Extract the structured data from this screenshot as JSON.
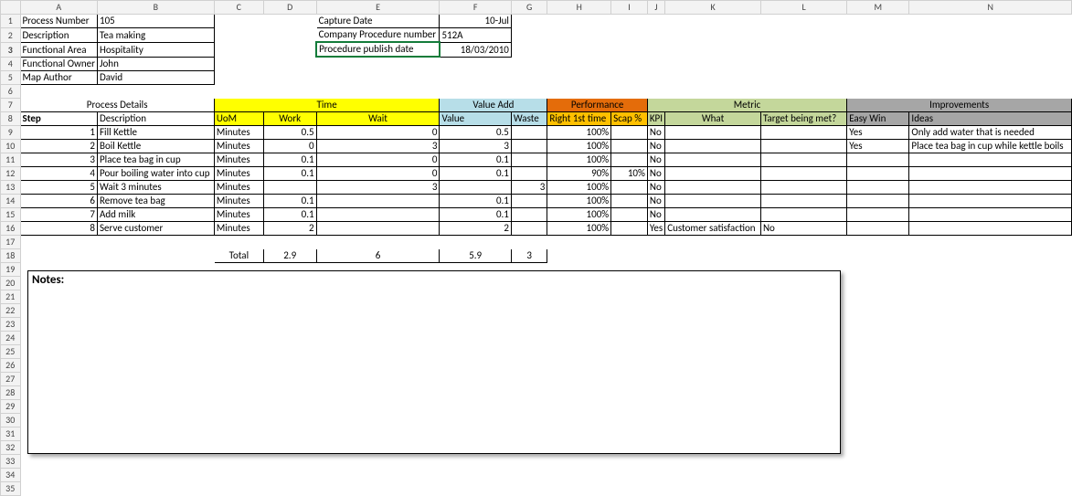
{
  "columns": [
    "",
    "A",
    "B",
    "C",
    "D",
    "E",
    "F",
    "G",
    "H",
    "I",
    "J",
    "K",
    "L",
    "M",
    "N"
  ],
  "rowNumbers": [
    1,
    2,
    3,
    4,
    5,
    6,
    7,
    8,
    9,
    10,
    11,
    12,
    13,
    14,
    15,
    16,
    17,
    18,
    19,
    20,
    21,
    22,
    23,
    24,
    25,
    26,
    27,
    28,
    29,
    30,
    31,
    32,
    33,
    34,
    35
  ],
  "meta": {
    "processNumberLabel": "Process  Number",
    "processNumber": "105",
    "descriptionLabel": "Description",
    "description": "Tea making",
    "functionalAreaLabel": "Functional Area",
    "functionalArea": "Hospitality",
    "functionalOwnerLabel": "Functional Owner",
    "functionalOwner": "John",
    "mapAuthorLabel": "Map Author",
    "mapAuthor": "David",
    "captureDateLabel": "Capture Date",
    "captureDate": "10-Jul",
    "companyProcLabel": "Company Procedure number",
    "companyProc": "512A",
    "publishDateLabel": "Procedure publish date",
    "publishDate": "18/03/2010"
  },
  "groupHeaders": {
    "processDetails": "Process Details",
    "time": "Time",
    "valueAdd": "Value Add",
    "performance": "Performance",
    "metric": "Metric",
    "improvements": "Improvements"
  },
  "headers": {
    "step": "Step",
    "desc": "Description",
    "uom": "UoM",
    "work": "Work",
    "wait": "Wait",
    "value": "Value",
    "waste": "Waste",
    "right": "Right 1st time",
    "scap": "Scap %",
    "kpi": "KPI",
    "what": "What",
    "target": "Target being met?",
    "easy": "Easy Win",
    "ideas": "Ideas"
  },
  "rows": [
    {
      "step": "1",
      "desc": "Fill Kettle",
      "uom": "Minutes",
      "work": "0.5",
      "wait": "0",
      "value": "0.5",
      "waste": "",
      "right": "100%",
      "scap": "",
      "kpi": "No",
      "what": "",
      "target": "",
      "easy": "Yes",
      "ideas": "Only add water that is needed"
    },
    {
      "step": "2",
      "desc": "Boil Kettle",
      "uom": "Minutes",
      "work": "0",
      "wait": "3",
      "value": "3",
      "waste": "",
      "right": "100%",
      "scap": "",
      "kpi": "No",
      "what": "",
      "target": "",
      "easy": "Yes",
      "ideas": "Place tea bag in cup while kettle boils"
    },
    {
      "step": "3",
      "desc": "Place tea bag in cup",
      "uom": "Minutes",
      "work": "0.1",
      "wait": "0",
      "value": "0.1",
      "waste": "",
      "right": "100%",
      "scap": "",
      "kpi": "No",
      "what": "",
      "target": "",
      "easy": "",
      "ideas": ""
    },
    {
      "step": "4",
      "desc": "Pour boiling water into cup",
      "uom": "Minutes",
      "work": "0.1",
      "wait": "0",
      "value": "0.1",
      "waste": "",
      "right": "90%",
      "scap": "10%",
      "kpi": "No",
      "what": "",
      "target": "",
      "easy": "",
      "ideas": ""
    },
    {
      "step": "5",
      "desc": "Wait 3 minutes",
      "uom": "Minutes",
      "work": "",
      "wait": "3",
      "value": "",
      "waste": "3",
      "right": "100%",
      "scap": "",
      "kpi": "No",
      "what": "",
      "target": "",
      "easy": "",
      "ideas": ""
    },
    {
      "step": "6",
      "desc": "Remove tea bag",
      "uom": "Minutes",
      "work": "0.1",
      "wait": "",
      "value": "0.1",
      "waste": "",
      "right": "100%",
      "scap": "",
      "kpi": "No",
      "what": "",
      "target": "",
      "easy": "",
      "ideas": ""
    },
    {
      "step": "7",
      "desc": "Add milk",
      "uom": "Minutes",
      "work": "0.1",
      "wait": "",
      "value": "0.1",
      "waste": "",
      "right": "100%",
      "scap": "",
      "kpi": "No",
      "what": "",
      "target": "",
      "easy": "",
      "ideas": ""
    },
    {
      "step": "8",
      "desc": "Serve customer",
      "uom": "Minutes",
      "work": "2",
      "wait": "",
      "value": "2",
      "waste": "",
      "right": "100%",
      "scap": "",
      "kpi": "Yes",
      "what": "Customer satisfaction",
      "target": "No",
      "easy": "",
      "ideas": ""
    }
  ],
  "totals": {
    "label": "Total",
    "work": "2.9",
    "wait": "6",
    "value": "5.9",
    "waste": "3"
  },
  "notesLabel": "Notes:"
}
